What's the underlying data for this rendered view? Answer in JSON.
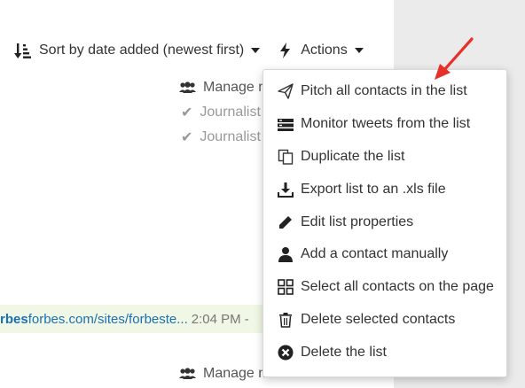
{
  "toolbar": {
    "sort_icon": "sort-amount-down-icon",
    "sort_label": "Sort by date added (newest first)",
    "actions_icon": "bolt-icon",
    "actions_label": "Actions"
  },
  "background": {
    "manage_label_1": "Manage m",
    "journalist_1": "Journalist",
    "journalist_2": "Journalist",
    "link_bold": "rbes",
    "link_url": "forbes.com/sites/forbeste...",
    "link_time": "2:04 PM -",
    "manage_label_2": "Manage media list"
  },
  "menu": {
    "items": [
      {
        "label": "Pitch all contacts in the list",
        "icon": "paper-plane-icon"
      },
      {
        "label": "Monitor tweets from the list",
        "icon": "tweets-feed-icon"
      },
      {
        "label": "Duplicate the list",
        "icon": "copy-icon"
      },
      {
        "label": "Export list to an .xls file",
        "icon": "download-icon"
      },
      {
        "label": "Edit list properties",
        "icon": "pencil-icon"
      },
      {
        "label": "Add a contact manually",
        "icon": "user-icon"
      },
      {
        "label": "Select all contacts on the page",
        "icon": "grid-icon"
      },
      {
        "label": "Delete selected contacts",
        "icon": "trash-icon"
      },
      {
        "label": "Delete the list",
        "icon": "times-circle-icon"
      }
    ]
  },
  "colors": {
    "annotation_arrow": "#e8302a",
    "link": "#1a6fb5",
    "link_row_bg": "#f0f7e4"
  }
}
